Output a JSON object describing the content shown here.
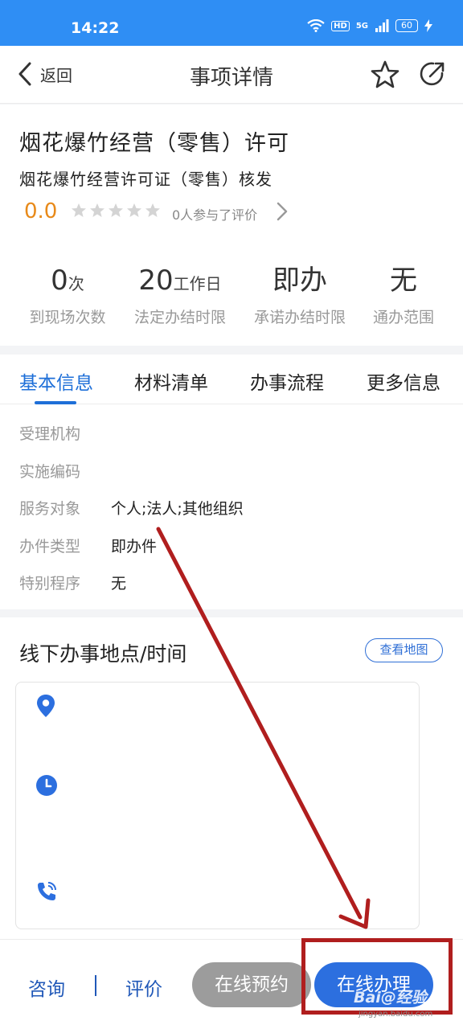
{
  "status_bar": {
    "time": "14:22",
    "hd": "HD",
    "network": "5G",
    "battery": "60"
  },
  "nav": {
    "back_label": "返回",
    "title": "事项详情"
  },
  "item": {
    "title": "烟花爆竹经营（零售）许可",
    "subtitle": "烟花爆竹经营许可证（零售）核发",
    "score": "0.0",
    "rating_text": "0人参与了评价",
    "stars_filled": 0,
    "stars_total": 5
  },
  "stats": [
    {
      "value": "0",
      "unit": "次",
      "label": "到现场次数"
    },
    {
      "value": "20",
      "unit": "工作日",
      "label": "法定办结时限"
    },
    {
      "value": "即办",
      "unit": "",
      "label": "承诺办结时限"
    },
    {
      "value": "无",
      "unit": "",
      "label": "通办范围"
    }
  ],
  "tabs": [
    {
      "label": "基本信息",
      "active": true
    },
    {
      "label": "材料清单",
      "active": false
    },
    {
      "label": "办事流程",
      "active": false
    },
    {
      "label": "更多信息",
      "active": false
    }
  ],
  "basic_info": [
    {
      "key": "受理机构",
      "value": ""
    },
    {
      "key": "实施编码",
      "value": ""
    },
    {
      "key": "服务对象",
      "value": "个人;法人;其他组织"
    },
    {
      "key": "办件类型",
      "value": "即办件"
    },
    {
      "key": "特别程序",
      "value": "无"
    }
  ],
  "office": {
    "title": "线下办事地点/时间",
    "map_button": "查看地图",
    "icons": [
      "location-pin-icon",
      "clock-icon",
      "phone-icon"
    ]
  },
  "bottom_bar": {
    "consult": "咨询",
    "rate": "评价",
    "reserve": "在线预约",
    "apply": "在线办理"
  },
  "watermark": {
    "text": "Bai@经验",
    "url": "jingyan.baidu.com"
  },
  "colors": {
    "primary": "#2c6fdf",
    "status_bar": "#2f8ef4",
    "score": "#e88a1a",
    "annotation": "#b01e1e",
    "button_gray": "#9c9c9c"
  }
}
